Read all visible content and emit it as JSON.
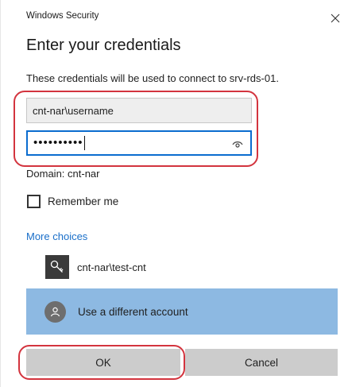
{
  "window": {
    "title": "Windows Security",
    "close_icon": "close-icon"
  },
  "dialog": {
    "heading": "Enter your credentials",
    "description": "These credentials will be used to connect to srv-rds-01."
  },
  "fields": {
    "username_value": "cnt-nar\\username",
    "password_mask": "••••••••••",
    "reveal_icon": "eye-icon"
  },
  "domain_text": "Domain: cnt-nar",
  "remember": {
    "label": "Remember me",
    "checked": false
  },
  "more_choices": {
    "label": "More choices",
    "color": "#1a6fc9"
  },
  "accounts": [
    {
      "icon": "key-icon",
      "label": "cnt-nar\\test-cnt",
      "selected": false
    },
    {
      "icon": "user-avatar-icon",
      "label": "Use a different account",
      "selected": true,
      "highlight_color": "#8db9e2"
    }
  ],
  "buttons": {
    "ok_label": "OK",
    "cancel_label": "Cancel"
  },
  "annotation_color": "#d3343e"
}
